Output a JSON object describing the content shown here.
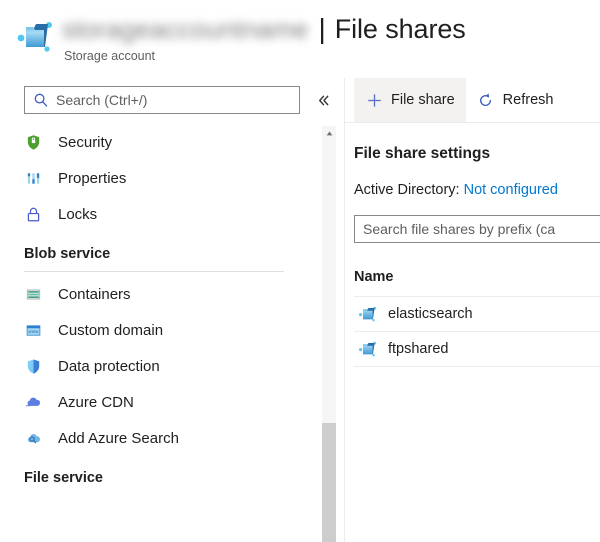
{
  "header": {
    "account_name_redacted": "storageaccountname",
    "separator": "|",
    "page_title": "File shares",
    "subtitle": "Storage account",
    "icon": "storage-account-icon"
  },
  "sidebar": {
    "search": {
      "placeholder": "Search (Ctrl+/)",
      "value": "",
      "icon": "search-icon"
    },
    "collapse_icon": "chevron-double-left-icon",
    "top_items": [
      {
        "label": "Security",
        "icon": "shield-lock-icon"
      },
      {
        "label": "Properties",
        "icon": "properties-bars-icon"
      },
      {
        "label": "Locks",
        "icon": "lock-icon"
      }
    ],
    "blob_group": {
      "heading": "Blob service",
      "items": [
        {
          "label": "Containers",
          "icon": "containers-icon"
        },
        {
          "label": "Custom domain",
          "icon": "custom-domain-icon"
        },
        {
          "label": "Data protection",
          "icon": "shield-icon"
        },
        {
          "label": "Azure CDN",
          "icon": "cloud-icon"
        },
        {
          "label": "Add Azure Search",
          "icon": "cloud-search-icon"
        }
      ]
    },
    "file_group": {
      "heading": "File service"
    },
    "scrollbar": {
      "up_arrow_icon": "caret-up-icon"
    }
  },
  "content": {
    "toolbar": {
      "file_share_label": "File share",
      "file_share_icon": "plus-icon",
      "refresh_label": "Refresh",
      "refresh_icon": "refresh-icon"
    },
    "settings_heading": "File share settings",
    "active_directory": {
      "label": "Active Directory:",
      "value": "Not configured"
    },
    "prefix_search": {
      "placeholder": "Search file shares by prefix (ca",
      "value": ""
    },
    "table": {
      "columns": [
        "Name"
      ],
      "rows": [
        {
          "name": "elasticsearch",
          "icon": "file-share-icon"
        },
        {
          "name": "ftpshared",
          "icon": "file-share-icon"
        }
      ]
    }
  },
  "colors": {
    "accent": "#0078d4",
    "text": "#201f1e",
    "muted": "#605e5c",
    "divider": "#edebe9",
    "hover": "#f3f2f1",
    "scroll_thumb": "#cdcdcd"
  }
}
